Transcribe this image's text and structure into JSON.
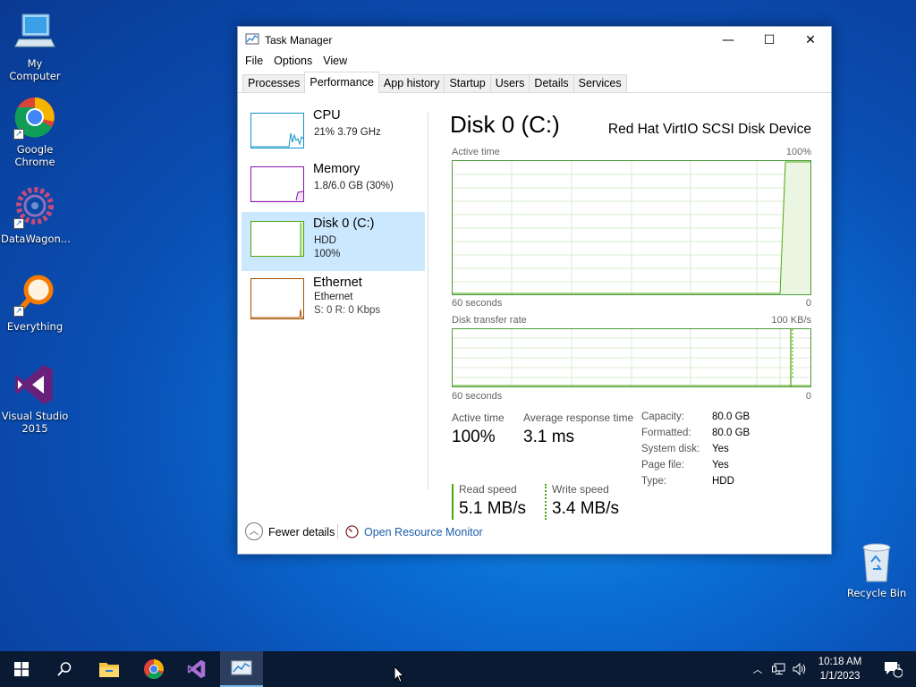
{
  "desktop": {
    "icons": [
      {
        "label": "My Computer"
      },
      {
        "label": "Google Chrome"
      },
      {
        "label": "DataWagon..."
      },
      {
        "label": "Everything"
      },
      {
        "label": "Visual Studio 2015"
      },
      {
        "label": "Recycle Bin"
      }
    ]
  },
  "window": {
    "title": "Task Manager",
    "controls": {
      "minimize": "—",
      "maximize": "☐",
      "close": "✕"
    },
    "menu": [
      "File",
      "Options",
      "View"
    ],
    "tabs": [
      "Processes",
      "Performance",
      "App history",
      "Startup",
      "Users",
      "Details",
      "Services"
    ],
    "active_tab": "Performance"
  },
  "perf_list": [
    {
      "name": "CPU",
      "line1": "21% 3.79 GHz",
      "line2": "",
      "color": "#1192c8"
    },
    {
      "name": "Memory",
      "line1": "1.8/6.0 GB (30%)",
      "line2": "",
      "color": "#8b12ae"
    },
    {
      "name": "Disk 0 (C:)",
      "line1": "HDD",
      "line2": "100%",
      "color": "#4da60c"
    },
    {
      "name": "Ethernet",
      "line1": "Ethernet",
      "line2": "S: 0 R: 0 Kbps",
      "color": "#a74f01"
    }
  ],
  "detail": {
    "title": "Disk 0 (C:)",
    "model": "Red Hat VirtIO SCSI Disk Device",
    "graph1": {
      "label": "Active time",
      "max": "100%",
      "left": "60 seconds",
      "right": "0"
    },
    "graph2": {
      "label": "Disk transfer rate",
      "max": "100 KB/s",
      "left": "60 seconds",
      "right": "0"
    },
    "stats": {
      "active_time_label": "Active time",
      "active_time": "100%",
      "avg_resp_label": "Average response time",
      "avg_resp": "3.1 ms",
      "read_label": "Read speed",
      "read": "5.1 MB/s",
      "write_label": "Write speed",
      "write": "3.4 MB/s"
    },
    "props": [
      {
        "label": "Capacity:",
        "value": "80.0 GB"
      },
      {
        "label": "Formatted:",
        "value": "80.0 GB"
      },
      {
        "label": "System disk:",
        "value": "Yes"
      },
      {
        "label": "Page file:",
        "value": "Yes"
      },
      {
        "label": "Type:",
        "value": "HDD"
      }
    ]
  },
  "footer": {
    "fewer_details": "Fewer details",
    "open_rm": "Open Resource Monitor"
  },
  "taskbar": {
    "time": "10:18 AM",
    "date": "1/1/2023",
    "notif_count": "1"
  }
}
